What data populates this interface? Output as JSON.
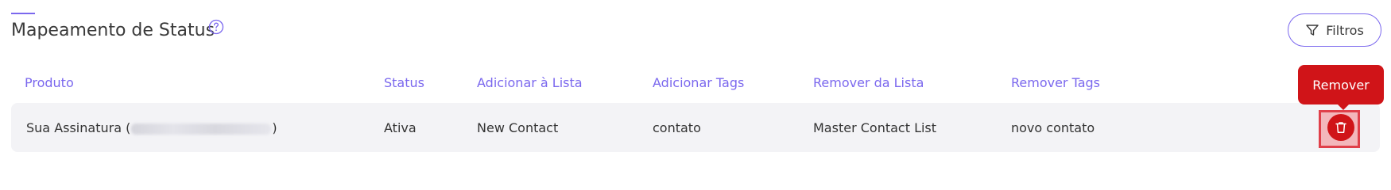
{
  "header": {
    "title": "Mapeamento de Status",
    "help_icon": "help-circle-icon",
    "filter_button": {
      "label": "Filtros",
      "icon": "filter-icon"
    }
  },
  "colors": {
    "accent": "#7b68ee",
    "danger": "#d01418",
    "row_background": "#f3f3f6"
  },
  "table": {
    "columns": [
      "Produto",
      "Status",
      "Adicionar à Lista",
      "Adicionar Tags",
      "Remover da Lista",
      "Remover Tags"
    ],
    "rows": [
      {
        "produto_prefix": "Sua Assinatura (",
        "produto_suffix": ")",
        "status": "Ativa",
        "adicionar_lista": "New Contact",
        "adicionar_tags": "contato",
        "remover_lista": "Master Contact List",
        "remover_tags": "novo contato",
        "action_icon": "trash-icon"
      }
    ]
  },
  "tooltip": {
    "text": "Remover"
  }
}
